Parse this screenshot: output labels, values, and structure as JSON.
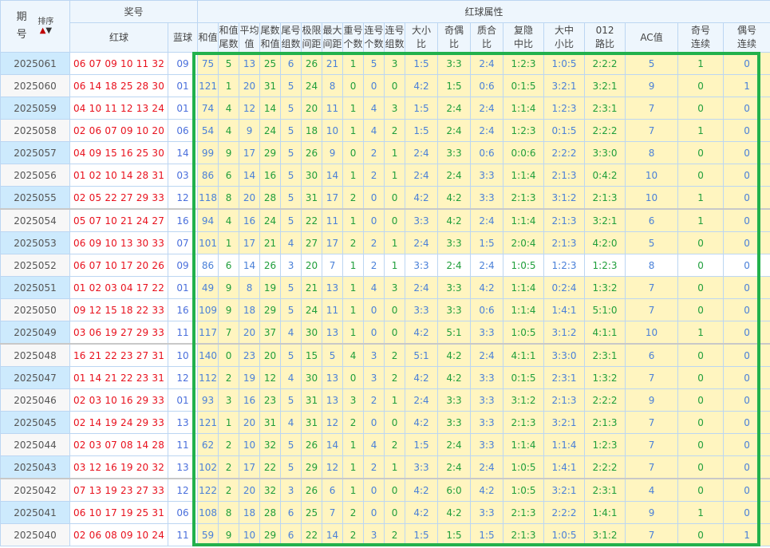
{
  "header": {
    "issue": "期号",
    "issue_top": "期",
    "issue_bottom": "号",
    "sort_label": "排序",
    "sort_up_icon": "▲",
    "sort_down_icon": "▼",
    "prize_group": "奖号",
    "red_group": "红球属性",
    "red_ball": "红球",
    "blue_ball": "蓝球",
    "attrs": [
      [
        "和值",
        ""
      ],
      [
        "和值",
        "尾数"
      ],
      [
        "平均",
        "值"
      ],
      [
        "尾数",
        "和值"
      ],
      [
        "尾号",
        "组数"
      ],
      [
        "极限",
        "间距"
      ],
      [
        "最大",
        "间距"
      ],
      [
        "重号",
        "个数"
      ],
      [
        "连号",
        "个数"
      ],
      [
        "连号",
        "组数"
      ],
      [
        "大小",
        "比"
      ],
      [
        "奇偶",
        "比"
      ],
      [
        "质合",
        "比"
      ],
      [
        "复隐",
        "中比"
      ],
      [
        "大中",
        "小比"
      ],
      [
        "012",
        "路比"
      ],
      [
        "AC值",
        ""
      ],
      [
        "奇号",
        "连续"
      ],
      [
        "偶号",
        "连续"
      ]
    ]
  },
  "colors": {
    "accent_frame": "#22b14c",
    "red_ball": "#e8101c",
    "blue_ball": "#4a6fdc",
    "attr_bg": "#fff5c0",
    "col_blue": "#4a80d8",
    "col_green": "#1f9e3a"
  },
  "rows": [
    [
      "2025061",
      "06 07 09 10 11 32",
      "09",
      "75",
      "5",
      "13",
      "25",
      "6",
      "26",
      "21",
      "1",
      "5",
      "3",
      "1:5",
      "3:3",
      "2:4",
      "1:2:3",
      "1:0:5",
      "2:2:2",
      "5",
      "1",
      "0"
    ],
    [
      "2025060",
      "06 14 18 25 28 30",
      "01",
      "121",
      "1",
      "20",
      "31",
      "5",
      "24",
      "8",
      "0",
      "0",
      "0",
      "4:2",
      "1:5",
      "0:6",
      "0:1:5",
      "3:2:1",
      "3:2:1",
      "9",
      "0",
      "1"
    ],
    [
      "2025059",
      "04 10 11 12 13 24",
      "01",
      "74",
      "4",
      "12",
      "14",
      "5",
      "20",
      "11",
      "1",
      "4",
      "3",
      "1:5",
      "2:4",
      "2:4",
      "1:1:4",
      "1:2:3",
      "2:3:1",
      "7",
      "0",
      "0"
    ],
    [
      "2025058",
      "02 06 07 09 10 20",
      "06",
      "54",
      "4",
      "9",
      "24",
      "5",
      "18",
      "10",
      "1",
      "4",
      "2",
      "1:5",
      "2:4",
      "2:4",
      "1:2:3",
      "0:1:5",
      "2:2:2",
      "7",
      "1",
      "0"
    ],
    [
      "2025057",
      "04 09 15 16 25 30",
      "14",
      "99",
      "9",
      "17",
      "29",
      "5",
      "26",
      "9",
      "0",
      "2",
      "1",
      "2:4",
      "3:3",
      "0:6",
      "0:0:6",
      "2:2:2",
      "3:3:0",
      "8",
      "0",
      "0"
    ],
    [
      "2025056",
      "01 02 10 14 28 31",
      "03",
      "86",
      "6",
      "14",
      "16",
      "5",
      "30",
      "14",
      "1",
      "2",
      "1",
      "2:4",
      "2:4",
      "3:3",
      "1:1:4",
      "2:1:3",
      "0:4:2",
      "10",
      "0",
      "0"
    ],
    [
      "2025055",
      "02 05 22 27 29 33",
      "12",
      "118",
      "8",
      "20",
      "28",
      "5",
      "31",
      "17",
      "2",
      "0",
      "0",
      "4:2",
      "4:2",
      "3:3",
      "2:1:3",
      "3:1:2",
      "2:1:3",
      "10",
      "1",
      "0"
    ],
    [
      "2025054",
      "05 07 10 21 24 27",
      "16",
      "94",
      "4",
      "16",
      "24",
      "5",
      "22",
      "11",
      "1",
      "0",
      "0",
      "3:3",
      "4:2",
      "2:4",
      "1:1:4",
      "2:1:3",
      "3:2:1",
      "6",
      "1",
      "0"
    ],
    [
      "2025053",
      "06 09 10 13 30 33",
      "07",
      "101",
      "1",
      "17",
      "21",
      "4",
      "27",
      "17",
      "2",
      "2",
      "1",
      "2:4",
      "3:3",
      "1:5",
      "2:0:4",
      "2:1:3",
      "4:2:0",
      "5",
      "0",
      "0"
    ],
    [
      "2025052",
      "06 07 10 17 20 26",
      "09",
      "86",
      "6",
      "14",
      "26",
      "3",
      "20",
      "7",
      "1",
      "2",
      "1",
      "3:3",
      "2:4",
      "2:4",
      "1:0:5",
      "1:2:3",
      "1:2:3",
      "8",
      "0",
      "0"
    ],
    [
      "2025051",
      "01 02 03 04 17 22",
      "01",
      "49",
      "9",
      "8",
      "19",
      "5",
      "21",
      "13",
      "1",
      "4",
      "3",
      "2:4",
      "3:3",
      "4:2",
      "1:1:4",
      "0:2:4",
      "1:3:2",
      "7",
      "0",
      "0"
    ],
    [
      "2025050",
      "09 12 15 18 22 33",
      "16",
      "109",
      "9",
      "18",
      "29",
      "5",
      "24",
      "11",
      "1",
      "0",
      "0",
      "3:3",
      "3:3",
      "0:6",
      "1:1:4",
      "1:4:1",
      "5:1:0",
      "7",
      "0",
      "0"
    ],
    [
      "2025049",
      "03 06 19 27 29 33",
      "11",
      "117",
      "7",
      "20",
      "37",
      "4",
      "30",
      "13",
      "1",
      "0",
      "0",
      "4:2",
      "5:1",
      "3:3",
      "1:0:5",
      "3:1:2",
      "4:1:1",
      "10",
      "1",
      "0"
    ],
    [
      "2025048",
      "16 21 22 23 27 31",
      "10",
      "140",
      "0",
      "23",
      "20",
      "5",
      "15",
      "5",
      "4",
      "3",
      "2",
      "5:1",
      "4:2",
      "2:4",
      "4:1:1",
      "3:3:0",
      "2:3:1",
      "6",
      "0",
      "0"
    ],
    [
      "2025047",
      "01 14 21 22 23 31",
      "12",
      "112",
      "2",
      "19",
      "12",
      "4",
      "30",
      "13",
      "0",
      "3",
      "2",
      "4:2",
      "4:2",
      "3:3",
      "0:1:5",
      "2:3:1",
      "1:3:2",
      "7",
      "0",
      "0"
    ],
    [
      "2025046",
      "02 03 10 16 29 33",
      "01",
      "93",
      "3",
      "16",
      "23",
      "5",
      "31",
      "13",
      "3",
      "2",
      "1",
      "2:4",
      "3:3",
      "3:3",
      "3:1:2",
      "2:1:3",
      "2:2:2",
      "9",
      "0",
      "0"
    ],
    [
      "2025045",
      "02 14 19 24 29 33",
      "13",
      "121",
      "1",
      "20",
      "31",
      "4",
      "31",
      "12",
      "2",
      "0",
      "0",
      "4:2",
      "3:3",
      "3:3",
      "2:1:3",
      "3:2:1",
      "2:1:3",
      "7",
      "0",
      "0"
    ],
    [
      "2025044",
      "02 03 07 08 14 28",
      "11",
      "62",
      "2",
      "10",
      "32",
      "5",
      "26",
      "14",
      "1",
      "4",
      "2",
      "1:5",
      "2:4",
      "3:3",
      "1:1:4",
      "1:1:4",
      "1:2:3",
      "7",
      "0",
      "0"
    ],
    [
      "2025043",
      "03 12 16 19 20 32",
      "13",
      "102",
      "2",
      "17",
      "22",
      "5",
      "29",
      "12",
      "1",
      "2",
      "1",
      "3:3",
      "2:4",
      "2:4",
      "1:0:5",
      "1:4:1",
      "2:2:2",
      "7",
      "0",
      "0"
    ],
    [
      "2025042",
      "07 13 19 23 27 33",
      "12",
      "122",
      "2",
      "20",
      "32",
      "3",
      "26",
      "6",
      "1",
      "0",
      "0",
      "4:2",
      "6:0",
      "4:2",
      "1:0:5",
      "3:2:1",
      "2:3:1",
      "4",
      "0",
      "0"
    ],
    [
      "2025041",
      "06 10 17 19 25 31",
      "06",
      "108",
      "8",
      "18",
      "28",
      "6",
      "25",
      "7",
      "2",
      "0",
      "0",
      "4:2",
      "4:2",
      "3:3",
      "2:1:3",
      "2:2:2",
      "1:4:1",
      "9",
      "1",
      "0"
    ],
    [
      "2025040",
      "02 06 08 09 10 24",
      "11",
      "59",
      "9",
      "10",
      "29",
      "6",
      "22",
      "14",
      "2",
      "3",
      "2",
      "1:5",
      "1:5",
      "1:5",
      "2:1:3",
      "1:0:5",
      "3:1:2",
      "7",
      "0",
      "1"
    ]
  ]
}
